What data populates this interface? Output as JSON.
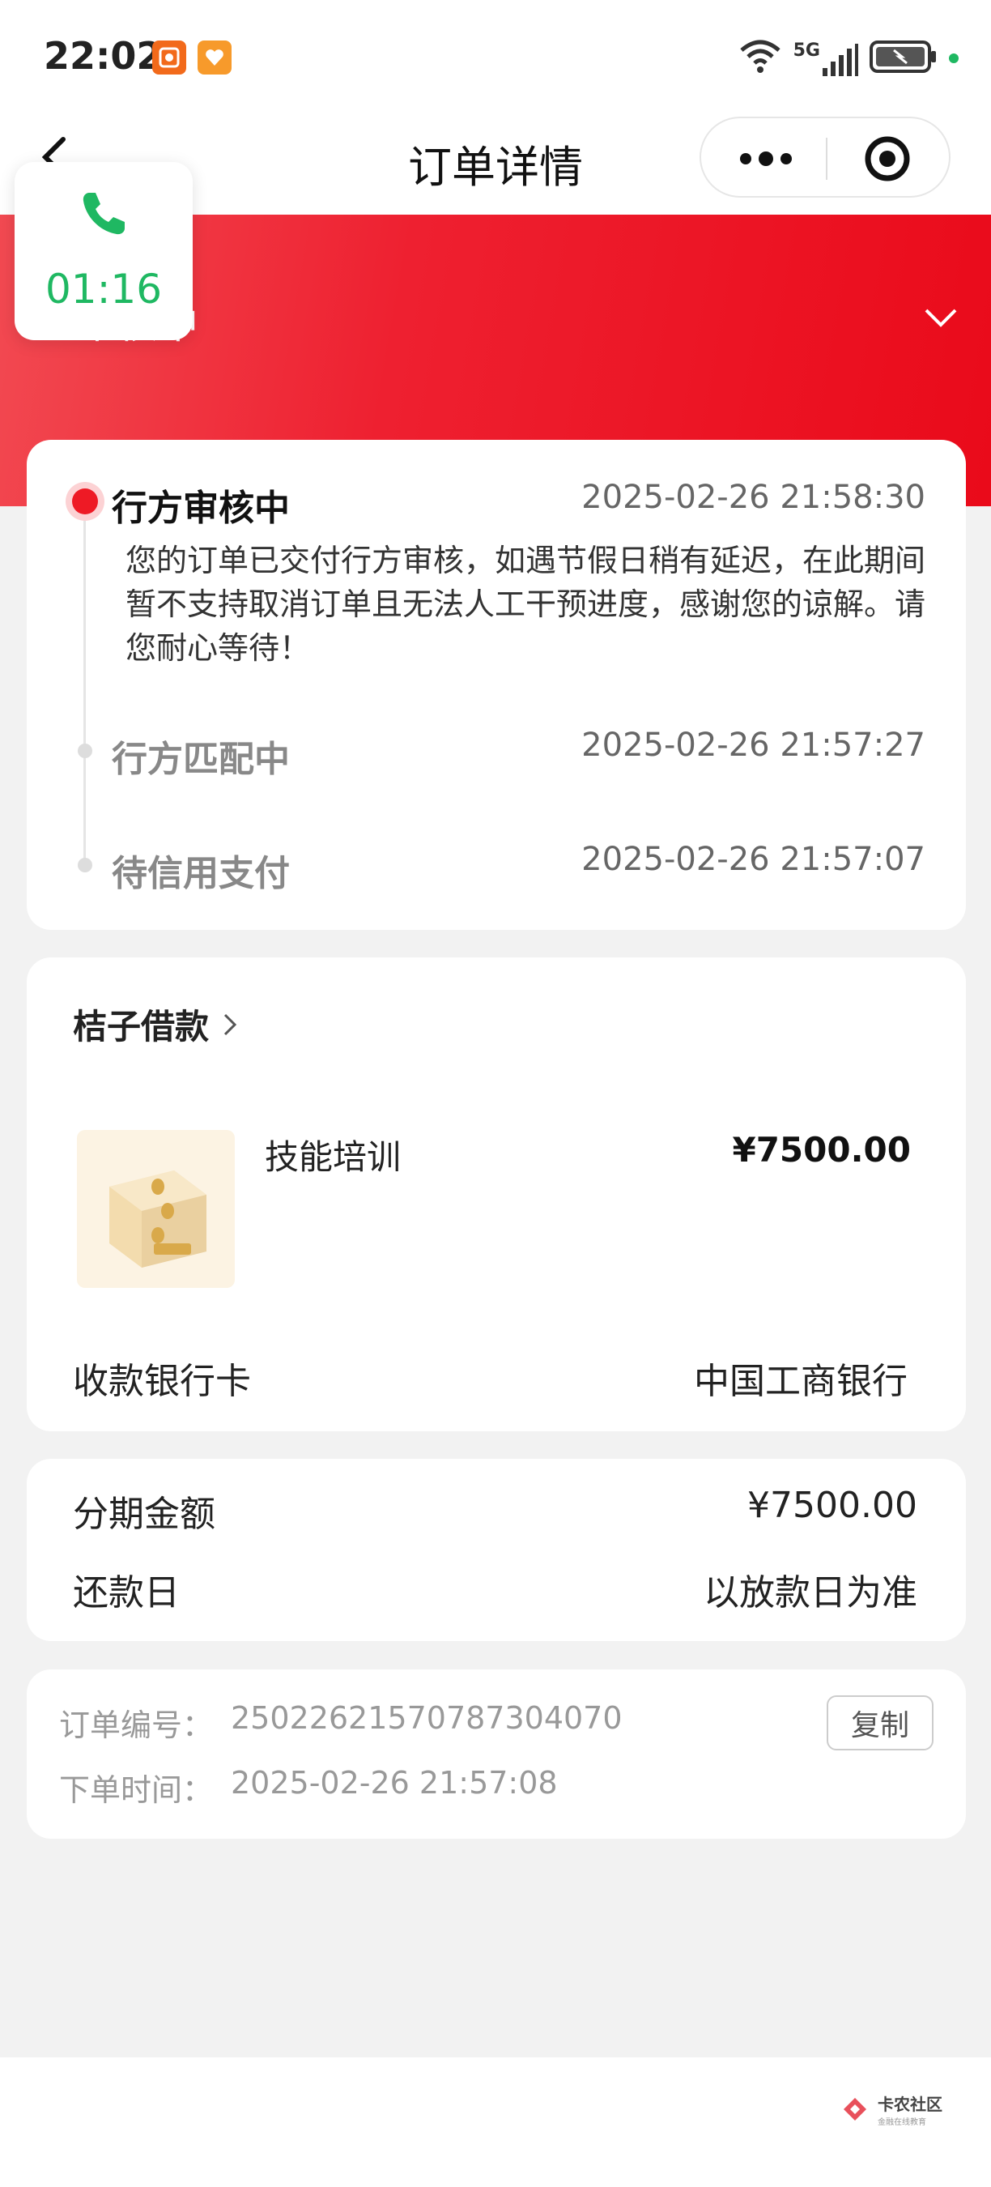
{
  "status_bar": {
    "time": "22:02",
    "network": "5G",
    "icons": [
      "app-icon-orange",
      "app-icon-heart",
      "wifi-icon",
      "signal-icon",
      "battery-icon"
    ]
  },
  "nav": {
    "title": "订单详情"
  },
  "call": {
    "timer": "01:16"
  },
  "banner": {
    "status": "审核中"
  },
  "timeline": [
    {
      "title": "行方审核中",
      "time": "2025-02-26 21:58:30",
      "desc": "您的订单已交付行方审核，如遇节假日稍有延迟，在此期间暂不支持取消订单且无法人工干预进度，感谢您的谅解。请您耐心等待！"
    },
    {
      "title": "行方匹配中",
      "time": "2025-02-26 21:57:27"
    },
    {
      "title": "待信用支付",
      "time": "2025-02-26 21:57:07"
    }
  ],
  "merchant": {
    "name": "桔子借款",
    "product": "技能培训",
    "price": "¥7500.00",
    "bank_label": "收款银行卡",
    "bank_value": "中国工商银行"
  },
  "installment": {
    "amount_label": "分期金额",
    "amount_value": "¥7500.00",
    "due_label": "还款日",
    "due_value": "以放款日为准"
  },
  "order": {
    "no_label": "订单编号：",
    "no_value": "25022621570787304070",
    "time_label": "下单时间：",
    "time_value": "2025-02-26 21:57:08",
    "copy_label": "复制"
  },
  "watermark": {
    "title": "卡农社区",
    "subtitle": "金融在线教育"
  },
  "colors": {
    "brand_red": "#ee1a25",
    "call_green": "#1fb862"
  }
}
